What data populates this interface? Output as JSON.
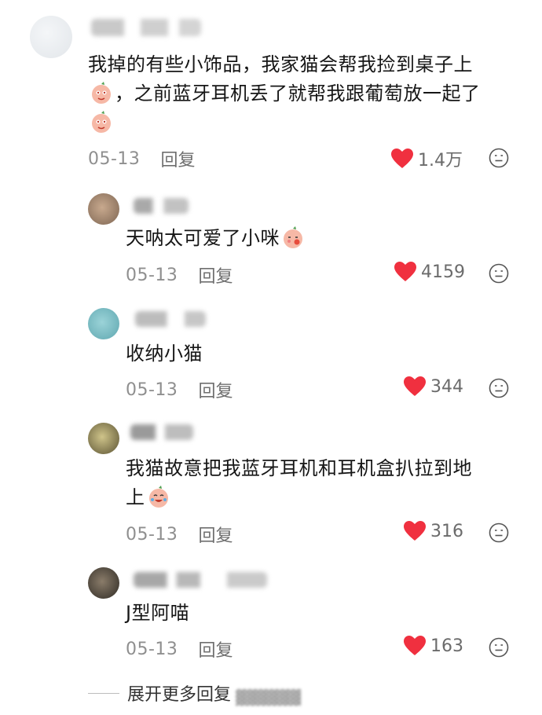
{
  "main_comment": {
    "text_line1": "我掉的有些小饰品，我家猫会帮我捡到桌子上",
    "text_line2": "，之前蓝牙耳机丢了就帮我跟葡萄放一起了",
    "date": "05-13",
    "reply_label": "回复",
    "likes": "1.4万",
    "stickers": [
      "peach-sticker-face"
    ]
  },
  "replies": [
    {
      "text": "天呐太可爱了小咪",
      "date": "05-13",
      "reply_label": "回复",
      "likes": "4159",
      "sticker": "peach-sticker-blush"
    },
    {
      "text": "收纳小猫",
      "date": "05-13",
      "reply_label": "回复",
      "likes": "344"
    },
    {
      "text_line1": "我猫故意把我蓝牙耳机和耳机盒扒拉到地",
      "text_line2": "上",
      "date": "05-13",
      "reply_label": "回复",
      "likes": "316",
      "sticker": "peach-sticker-cry-laugh"
    },
    {
      "text": "J型阿喵",
      "date": "05-13",
      "reply_label": "回复",
      "likes": "163"
    }
  ],
  "expand_more": "展开更多回复",
  "colors": {
    "heart": "#f0303f",
    "meta": "#8f8f8f",
    "text": "#161616"
  }
}
